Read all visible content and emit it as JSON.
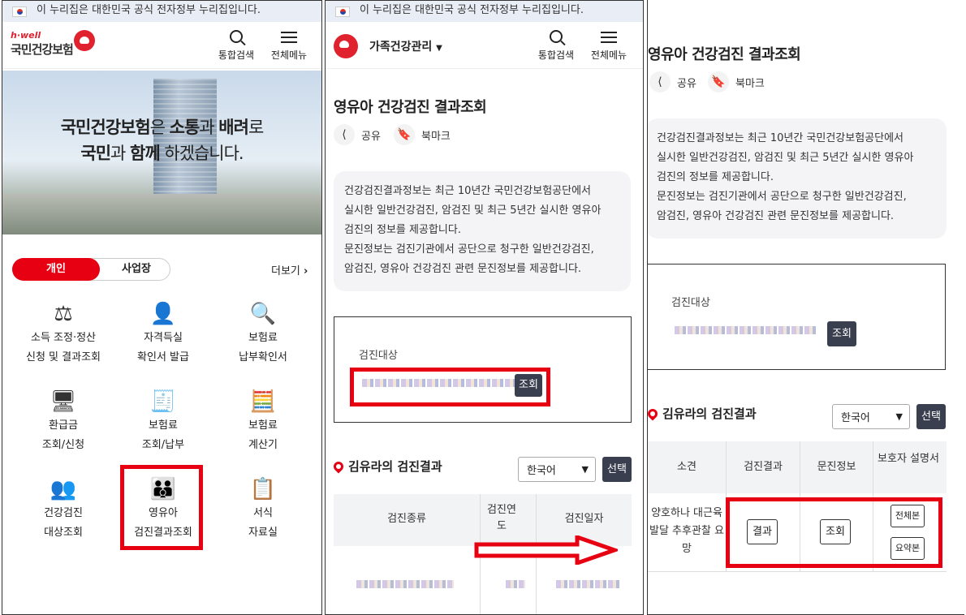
{
  "gov_banner": "이 누리집은 대한민국 공식 전자정부 누리집입니다.",
  "panel1": {
    "logo_small": "h·well",
    "logo_name": "국민건강보험",
    "header_buttons": [
      "통합검색",
      "전체메뉴"
    ],
    "hero_line1_parts": [
      "국민건강보험",
      "은 ",
      "소통",
      "과 ",
      "배려",
      "로"
    ],
    "hero_line2_parts": [
      "국민",
      "과 ",
      "함께",
      " 하겠습니다."
    ],
    "tabs": [
      "개인",
      "사업장"
    ],
    "more_label": "더보기",
    "menu": [
      {
        "l1": "소득 조정·정산",
        "l2": "신청 및 결과조회",
        "icon": "scale-icon"
      },
      {
        "l1": "자격득실",
        "l2": "확인서 발급",
        "icon": "person-heart-icon"
      },
      {
        "l1": "보험료",
        "l2": "납부확인서",
        "icon": "heart-search-icon"
      },
      {
        "l1": "환급금",
        "l2": "조회/신청",
        "icon": "monitor-won-icon"
      },
      {
        "l1": "보험료",
        "l2": "조회/납부",
        "icon": "monitor-receipt-icon"
      },
      {
        "l1": "보험료",
        "l2": "계산기",
        "icon": "calculator-icon"
      },
      {
        "l1": "건강검진",
        "l2": "대상조회",
        "icon": "people-search-icon"
      },
      {
        "l1": "영유아",
        "l2": "검진결과조회",
        "icon": "family-heart-icon"
      },
      {
        "l1": "서식",
        "l2": "자료실",
        "icon": "document-check-icon"
      }
    ]
  },
  "panel2": {
    "app_name": "가족건강관리",
    "header_buttons": [
      "통합검색",
      "전체메뉴"
    ],
    "title": "영유아 건강검진 결과조회",
    "share": "공유",
    "bookmark": "북마크",
    "info_lines": [
      "건강검진결과정보는 최근 10년간 국민건강보험공단에서",
      "실시한 일반건강검진, 암검진 및 최근 5년간 실시한 영유아",
      "검진의 정보를 제공합니다.",
      "문진정보는 검진기관에서 공단으로 청구한 일반건강검진,",
      "암검진, 영유아 건강검진 관련 문진정보를 제공합니다."
    ],
    "target_label": "검진대상",
    "search_btn": "조회",
    "section_title": "김유라의 검진결과",
    "language": "한국어",
    "select_btn": "선택",
    "table_headers": [
      "검진종류",
      "검진연도",
      "검진일자"
    ]
  },
  "panel3": {
    "title": "영유아 건강검진 결과조회",
    "share": "공유",
    "bookmark": "북마크",
    "info_lines": [
      "건강검진결과정보는 최근 10년간 국민건강보험공단에서",
      "실시한 일반건강검진, 암검진 및 최근 5년간 실시한 영유아",
      "검진의 정보를 제공합니다.",
      "문진정보는 검진기관에서 공단으로 청구한 일반건강검진,",
      "암검진, 영유아 건강검진 관련 문진정보를 제공합니다."
    ],
    "target_label": "검진대상",
    "search_btn": "조회",
    "section_title": "김유라의 검진결과",
    "language": "한국어",
    "select_btn": "선택",
    "table_headers": [
      "소견",
      "검진결과",
      "문진정보",
      "보호자 설명서"
    ],
    "finding_lines": [
      "양호하나 대근육",
      "발달 추후관찰 요",
      "망"
    ],
    "result_btn": "결과",
    "query_btn": "조회",
    "full_btn": "전체본",
    "summary_btn": "요약본"
  },
  "colors": {
    "accent": "#e60012",
    "dark_button": "#3a3f4f",
    "info_bg": "#f4f4f6"
  }
}
